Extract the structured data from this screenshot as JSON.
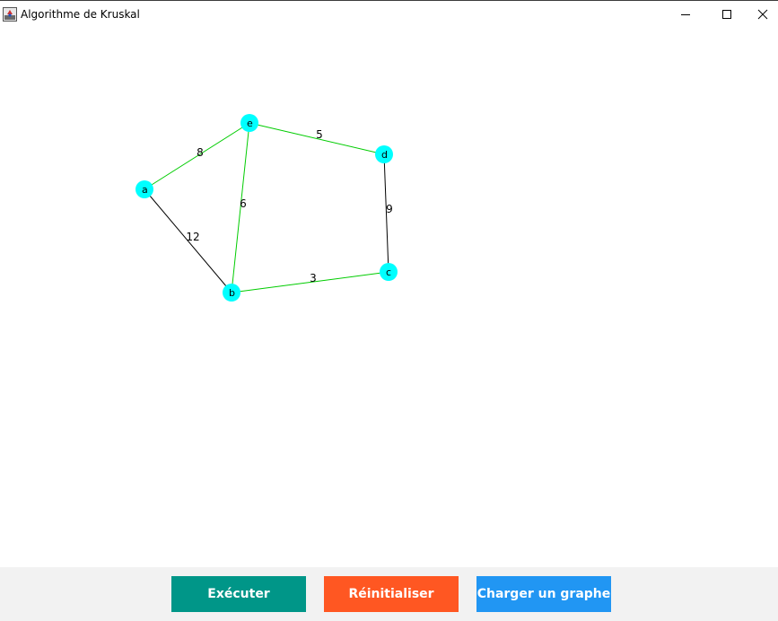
{
  "window": {
    "title": "Algorithme de Kruskal"
  },
  "colors": {
    "node_fill": "#00ffff",
    "mst_edge": "#00cc00",
    "other_edge": "#000000",
    "execute_button": "#009688",
    "reset_button": "#ff5722",
    "load_button": "#2196f3"
  },
  "graph": {
    "nodes": [
      {
        "id": "a",
        "label": "a"
      },
      {
        "id": "b",
        "label": "b"
      },
      {
        "id": "c",
        "label": "c"
      },
      {
        "id": "d",
        "label": "d"
      },
      {
        "id": "e",
        "label": "e"
      }
    ],
    "edges": [
      {
        "from": "a",
        "to": "e",
        "weight": "8",
        "in_mst": true
      },
      {
        "from": "e",
        "to": "d",
        "weight": "5",
        "in_mst": true
      },
      {
        "from": "e",
        "to": "b",
        "weight": "6",
        "in_mst": true
      },
      {
        "from": "a",
        "to": "b",
        "weight": "12",
        "in_mst": false
      },
      {
        "from": "d",
        "to": "c",
        "weight": "9",
        "in_mst": false
      },
      {
        "from": "b",
        "to": "c",
        "weight": "3",
        "in_mst": true
      }
    ]
  },
  "buttons": {
    "execute_label": "Exécuter",
    "reset_label": "Réinitialiser",
    "load_label": "Charger un graphe"
  }
}
